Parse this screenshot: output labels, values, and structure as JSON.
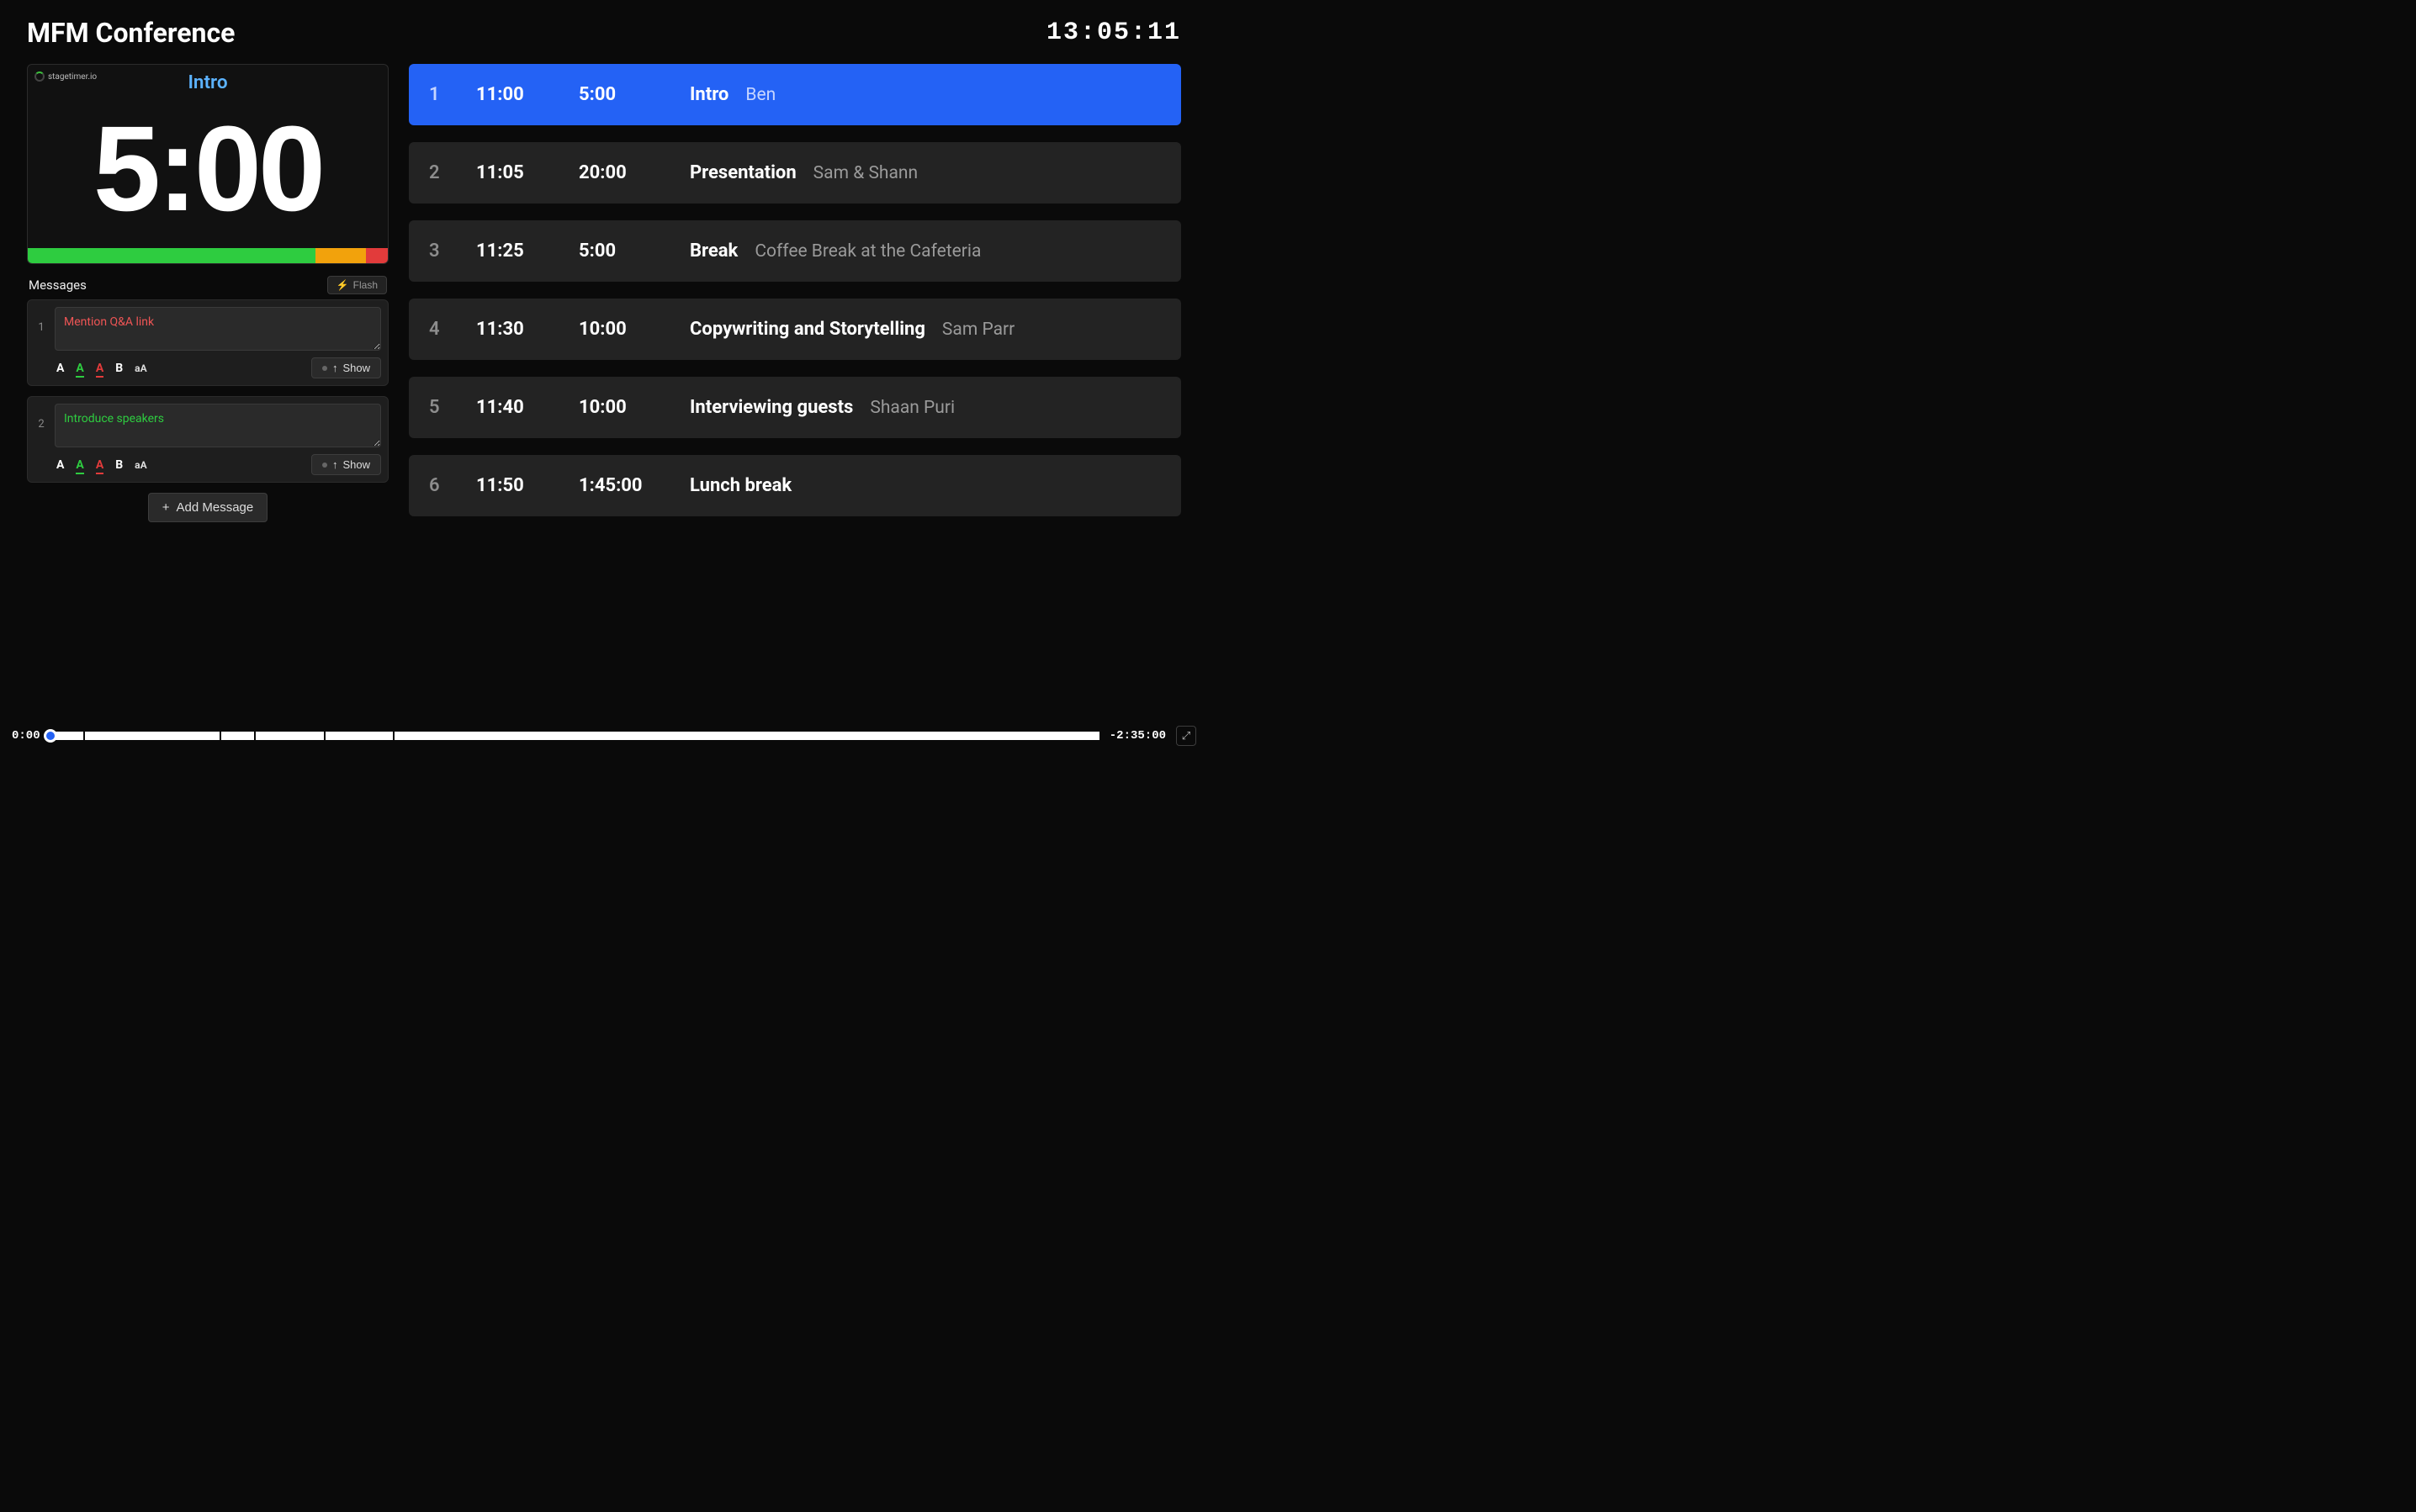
{
  "header": {
    "title": "MFM Conference",
    "clock": "13:05:11"
  },
  "timer": {
    "brand": "stagetimer.io",
    "label": "Intro",
    "display": "5:00",
    "progress": {
      "green_pct": 80,
      "orange_pct": 14,
      "red_pct": 6
    }
  },
  "messages": {
    "title": "Messages",
    "flash_label": "Flash",
    "show_label": "Show",
    "add_label": "Add Message",
    "items": [
      {
        "index": "1",
        "text": "Mention Q&A link",
        "color": "red"
      },
      {
        "index": "2",
        "text": "Introduce speakers",
        "color": "green"
      }
    ]
  },
  "agenda": [
    {
      "n": "1",
      "start": "11:00",
      "dur": "5:00",
      "title": "Intro",
      "who": "Ben",
      "active": true
    },
    {
      "n": "2",
      "start": "11:05",
      "dur": "20:00",
      "title": "Presentation",
      "who": "Sam & Shann",
      "active": false
    },
    {
      "n": "3",
      "start": "11:25",
      "dur": "5:00",
      "title": "Break",
      "who": "Coffee Break at the Cafeteria",
      "active": false
    },
    {
      "n": "4",
      "start": "11:30",
      "dur": "10:00",
      "title": "Copywriting and Storytelling",
      "who": "Sam Parr",
      "active": false
    },
    {
      "n": "5",
      "start": "11:40",
      "dur": "10:00",
      "title": "Interviewing guests",
      "who": "Shaan Puri",
      "active": false
    },
    {
      "n": "6",
      "start": "11:50",
      "dur": "1:45:00",
      "title": "Lunch break",
      "who": "",
      "active": false
    }
  ],
  "timeline": {
    "elapsed": "0:00",
    "remaining": "-2:35:00",
    "segments_pct": [
      3.2,
      12.9,
      3.2,
      6.5,
      6.5,
      67.7
    ]
  }
}
